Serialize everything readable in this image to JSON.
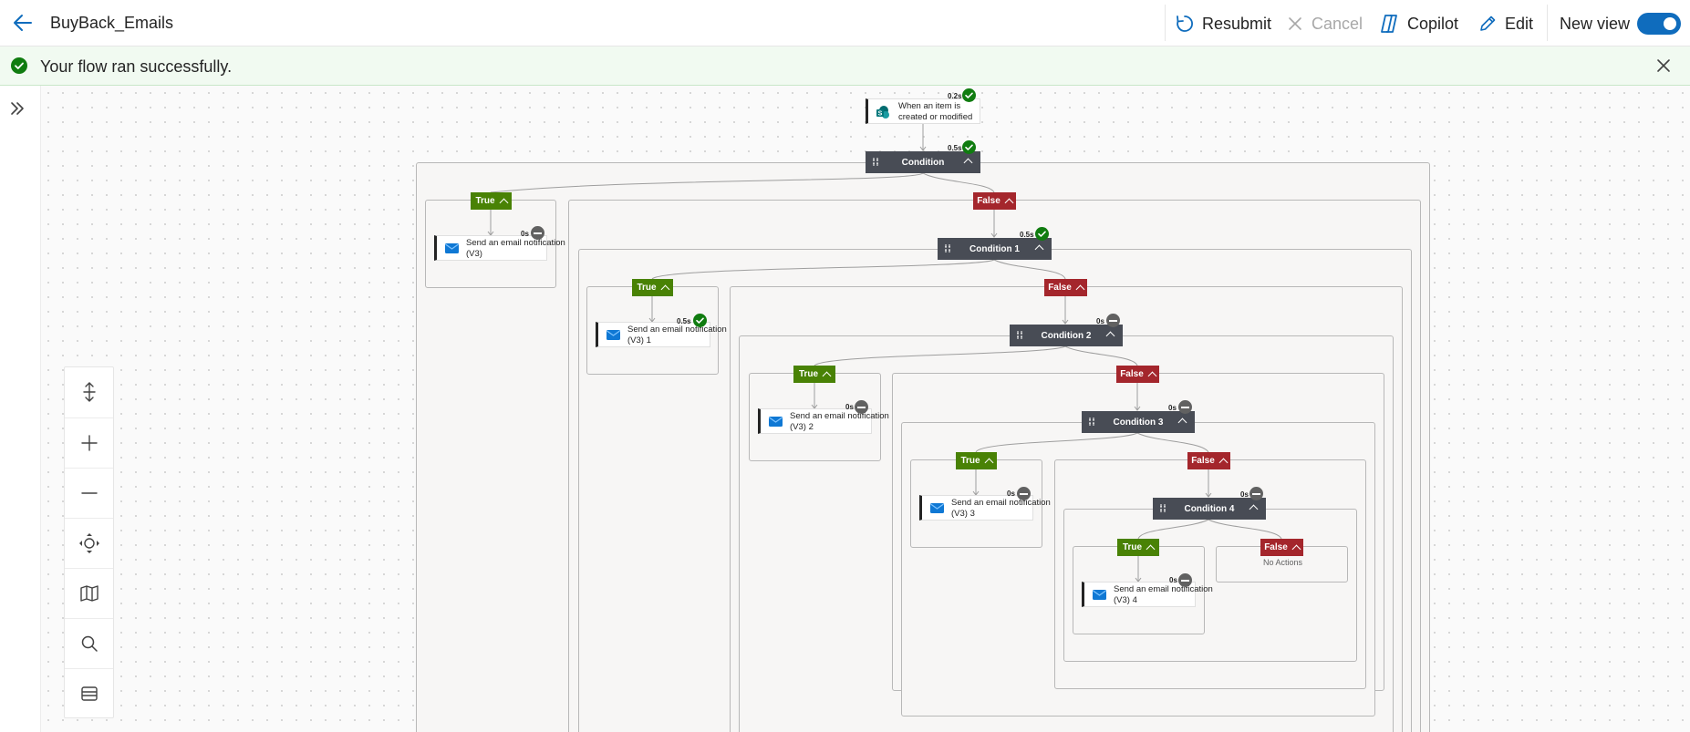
{
  "header": {
    "title": "BuyBack_Emails",
    "resubmit_label": "Resubmit",
    "cancel_label": "Cancel",
    "copilot_label": "Copilot",
    "edit_label": "Edit",
    "new_view_label": "New view",
    "new_view_on": true
  },
  "banner": {
    "message": "Your flow ran successfully.",
    "status": "success"
  },
  "colors": {
    "accent": "#0f6cbd",
    "success": "#107c10",
    "true_branch": "#498205",
    "false_branch": "#a4262c",
    "condition_block": "#484c55",
    "skipped": "#616161"
  },
  "flow": {
    "trigger": {
      "label": "When an item is created or modified",
      "duration": "0.2s",
      "status": "succeeded",
      "icon": "sharepoint-icon"
    },
    "conditions": [
      {
        "label": "Condition",
        "duration": "0.5s",
        "status": "succeeded"
      },
      {
        "label": "Condition 1",
        "duration": "0.5s",
        "status": "succeeded"
      },
      {
        "label": "Condition 2",
        "duration": "0s",
        "status": "skipped"
      },
      {
        "label": "Condition 3",
        "duration": "0s",
        "status": "skipped"
      },
      {
        "label": "Condition 4",
        "duration": "0s",
        "status": "skipped"
      }
    ],
    "branch_true_label": "True",
    "branch_false_label": "False",
    "actions": [
      {
        "label": "Send an email notification (V3)",
        "duration": "0s",
        "status": "skipped",
        "icon": "outlook-mail-icon"
      },
      {
        "label": "Send an email notification (V3) 1",
        "duration": "0.5s",
        "status": "succeeded",
        "icon": "outlook-mail-icon"
      },
      {
        "label": "Send an email notification (V3) 2",
        "duration": "0s",
        "status": "skipped",
        "icon": "outlook-mail-icon"
      },
      {
        "label": "Send an email notification (V3) 3",
        "duration": "0s",
        "status": "skipped",
        "icon": "outlook-mail-icon"
      },
      {
        "label": "Send an email notification (V3) 4",
        "duration": "0s",
        "status": "skipped",
        "icon": "outlook-mail-icon"
      }
    ],
    "no_actions_label": "No Actions"
  },
  "canvas_controls": [
    "fit-height-icon",
    "zoom-in-icon",
    "zoom-out-icon",
    "fit-view-icon",
    "minimap-icon",
    "search-icon",
    "layers-icon"
  ]
}
